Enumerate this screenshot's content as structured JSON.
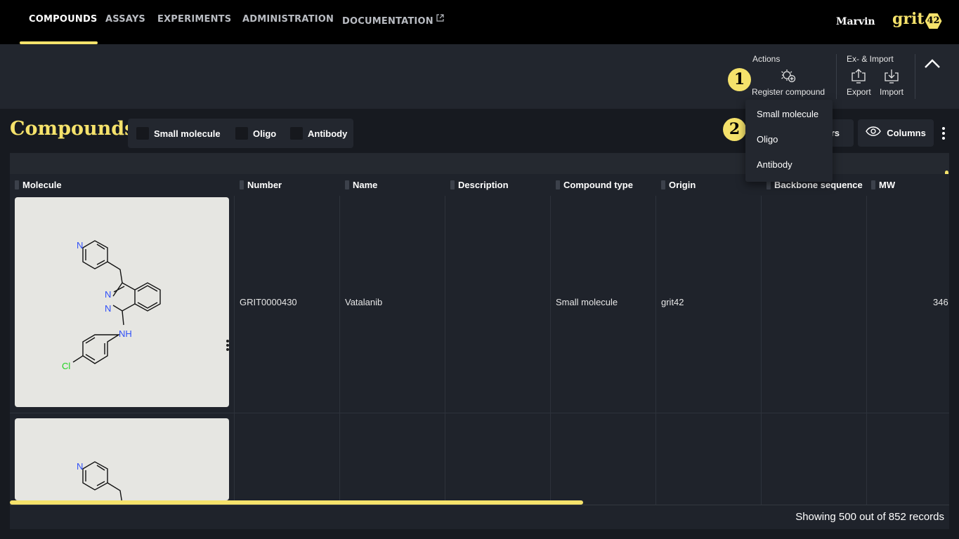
{
  "nav": {
    "items": [
      "COMPOUNDS",
      "ASSAYS",
      "EXPERIMENTS",
      "ADMINISTRATION",
      "DOCUMENTATION"
    ],
    "active": "COMPOUNDS",
    "user": "Marvin",
    "logo_text": "grit",
    "logo_badge": "42"
  },
  "toolbar": {
    "actions_label": "Actions",
    "register_label": "Register compound",
    "eximport_label": "Ex- & Import",
    "export_label": "Export",
    "import_label": "Import"
  },
  "steps": [
    "1",
    "2"
  ],
  "page": {
    "title": "Compounds",
    "filters": [
      "Small molecule",
      "Oligo",
      "Antibody"
    ],
    "filters_button_label": "rs",
    "columns_button_label": "Columns"
  },
  "dropdown": {
    "items": [
      "Small molecule",
      "Oligo",
      "Antibody"
    ]
  },
  "table": {
    "columns": [
      "Molecule",
      "Number",
      "Name",
      "Description",
      "Compound type",
      "Origin",
      "Backbone sequence",
      "MW"
    ],
    "rows": [
      {
        "number": "GRIT0000430",
        "name": "Vatalanib",
        "description": "",
        "compound_type": "Small molecule",
        "origin": "grit42",
        "backbone_sequence": "",
        "mw": "346"
      }
    ],
    "molecule_atoms": {
      "n_pyridine": "N",
      "n1": "N",
      "n2": "N",
      "nh": "NH",
      "cl": "Cl"
    },
    "horizontal_scroll_fraction": 0.61,
    "footer": "Showing 500 out of 852 records"
  },
  "colors": {
    "accent": "#f5e26b",
    "nav_bg": "#000000",
    "toolbar_bg": "#22262e",
    "page_bg": "#171a20",
    "atom_n": "#3050f8",
    "atom_cl": "#1fd21f"
  }
}
